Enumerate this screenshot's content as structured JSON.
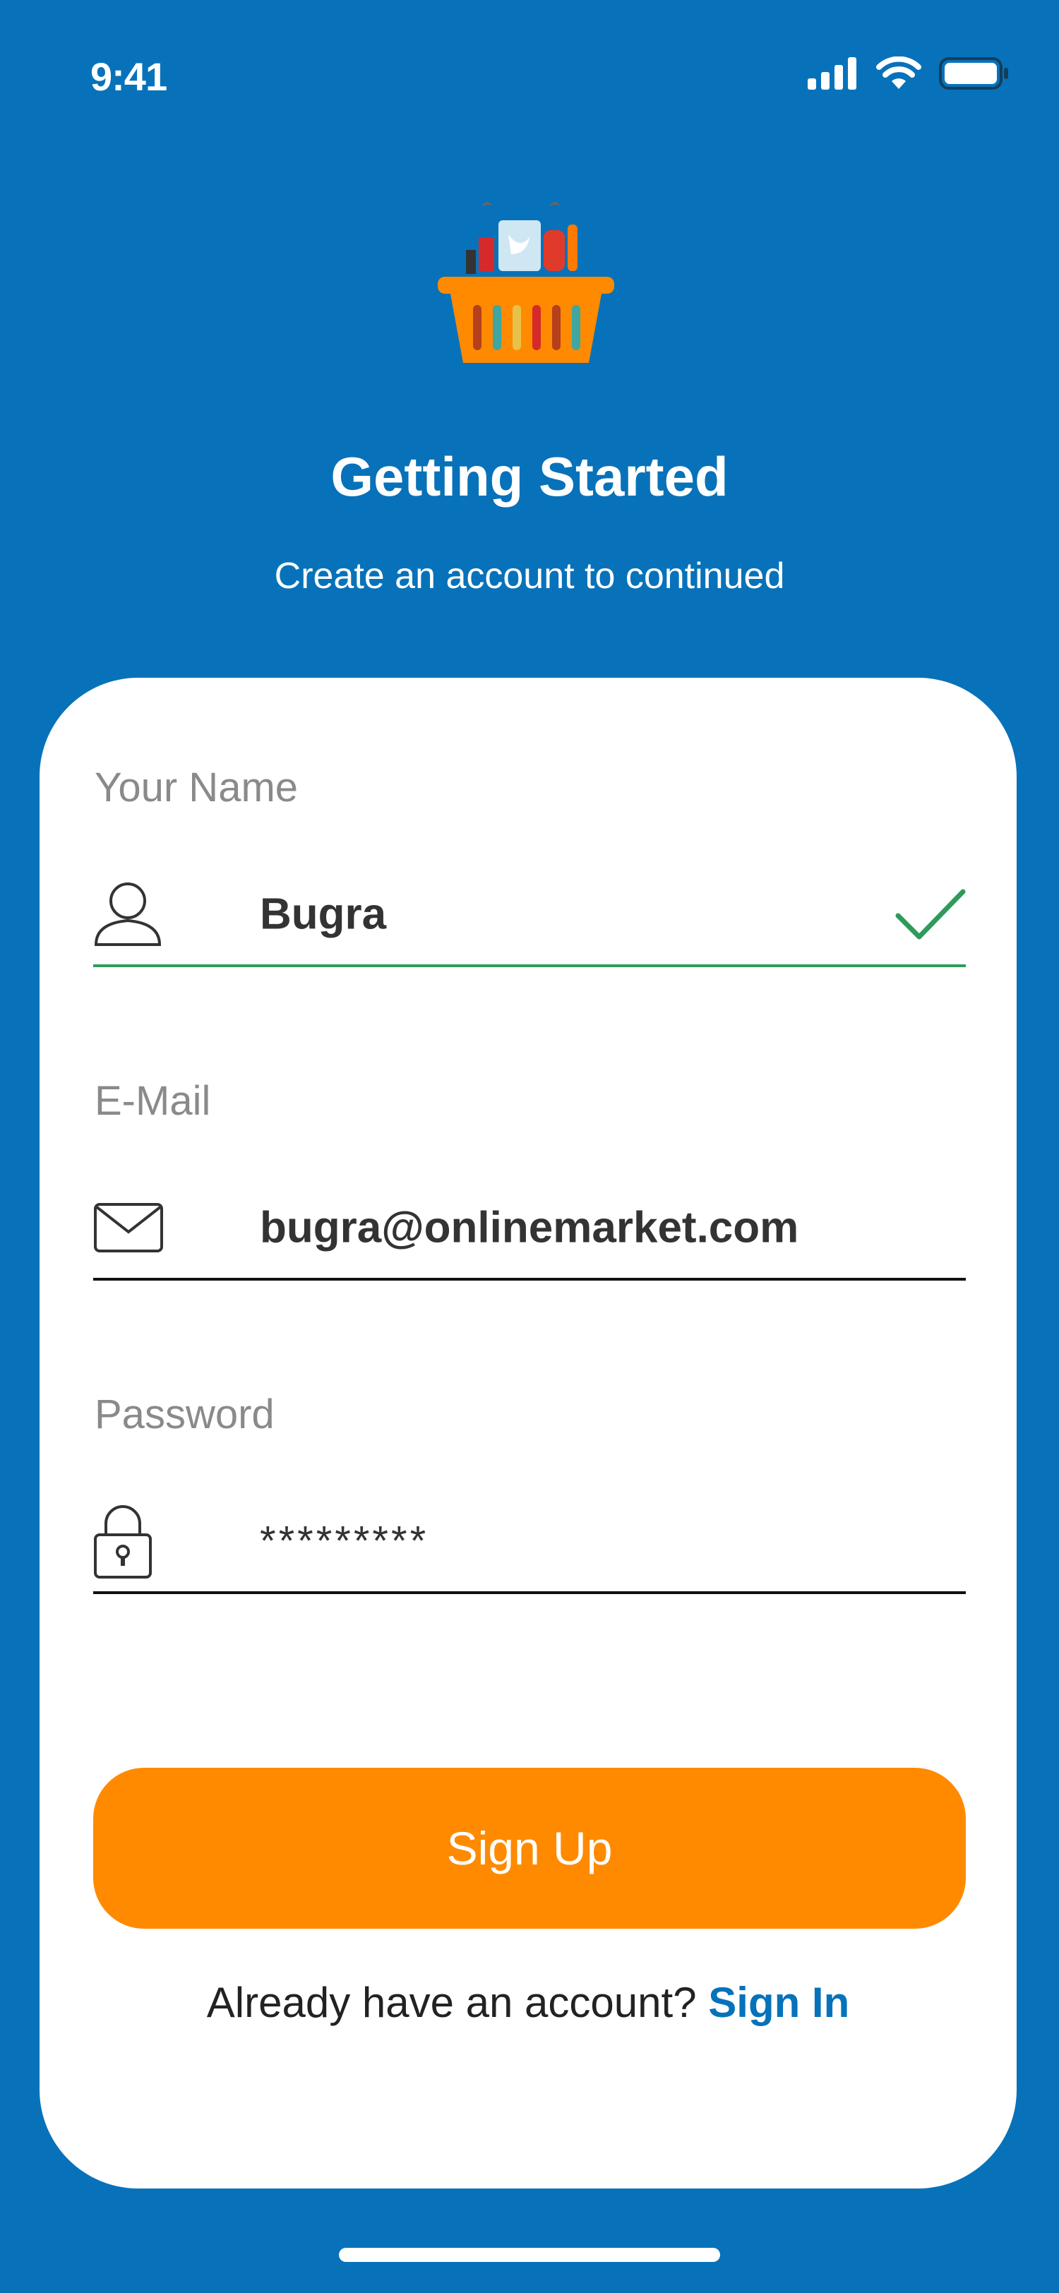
{
  "status_bar": {
    "time": "9:41",
    "icons": [
      "signal-icon",
      "wifi-icon",
      "battery-icon"
    ]
  },
  "logo": {
    "icon": "shopping-basket-icon"
  },
  "header": {
    "title": "Getting Started",
    "subtitle": "Create an account to continued"
  },
  "form": {
    "name": {
      "label": "Your Name",
      "value": "Bugra",
      "icon": "user-icon",
      "valid": true
    },
    "email": {
      "label": "E-Mail",
      "value": "bugra@onlinemarket.com",
      "icon": "mail-icon"
    },
    "password": {
      "label": "Password",
      "value": "*********",
      "icon": "lock-icon"
    }
  },
  "actions": {
    "signup_label": "Sign Up"
  },
  "footer": {
    "prompt": "Already have an account? ",
    "signin_label": "Sign In"
  },
  "colors": {
    "background": "#0772BA",
    "button": "#FF8A00",
    "valid": "#2E9B5A",
    "link": "#0772BA"
  }
}
